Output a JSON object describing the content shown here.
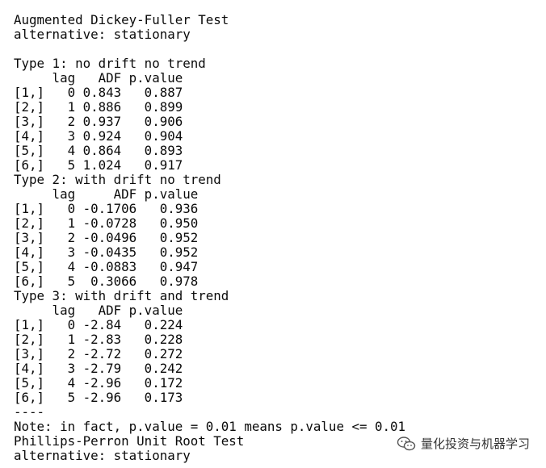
{
  "console": {
    "lines": [
      "Augmented Dickey-Fuller Test",
      "alternative: stationary",
      "",
      "Type 1: no drift no trend",
      "     lag   ADF p.value",
      "[1,]   0 0.843   0.887",
      "[2,]   1 0.886   0.899",
      "[3,]   2 0.937   0.906",
      "[4,]   3 0.924   0.904",
      "[5,]   4 0.864   0.893",
      "[6,]   5 1.024   0.917",
      "Type 2: with drift no trend",
      "     lag     ADF p.value",
      "[1,]   0 -0.1706   0.936",
      "[2,]   1 -0.0728   0.950",
      "[3,]   2 -0.0496   0.952",
      "[4,]   3 -0.0435   0.952",
      "[5,]   4 -0.0883   0.947",
      "[6,]   5  0.3066   0.978",
      "Type 3: with drift and trend",
      "     lag   ADF p.value",
      "[1,]   0 -2.84   0.224",
      "[2,]   1 -2.83   0.228",
      "[3,]   2 -2.72   0.272",
      "[4,]   3 -2.79   0.242",
      "[5,]   4 -2.96   0.172",
      "[6,]   5 -2.96   0.173",
      "----",
      "Note: in fact, p.value = 0.01 means p.value <= 0.01",
      "Phillips-Perron Unit Root Test",
      "alternative: stationary"
    ]
  },
  "watermark": {
    "text": "量化投资与机器学习",
    "icon": "wechat-icon"
  }
}
